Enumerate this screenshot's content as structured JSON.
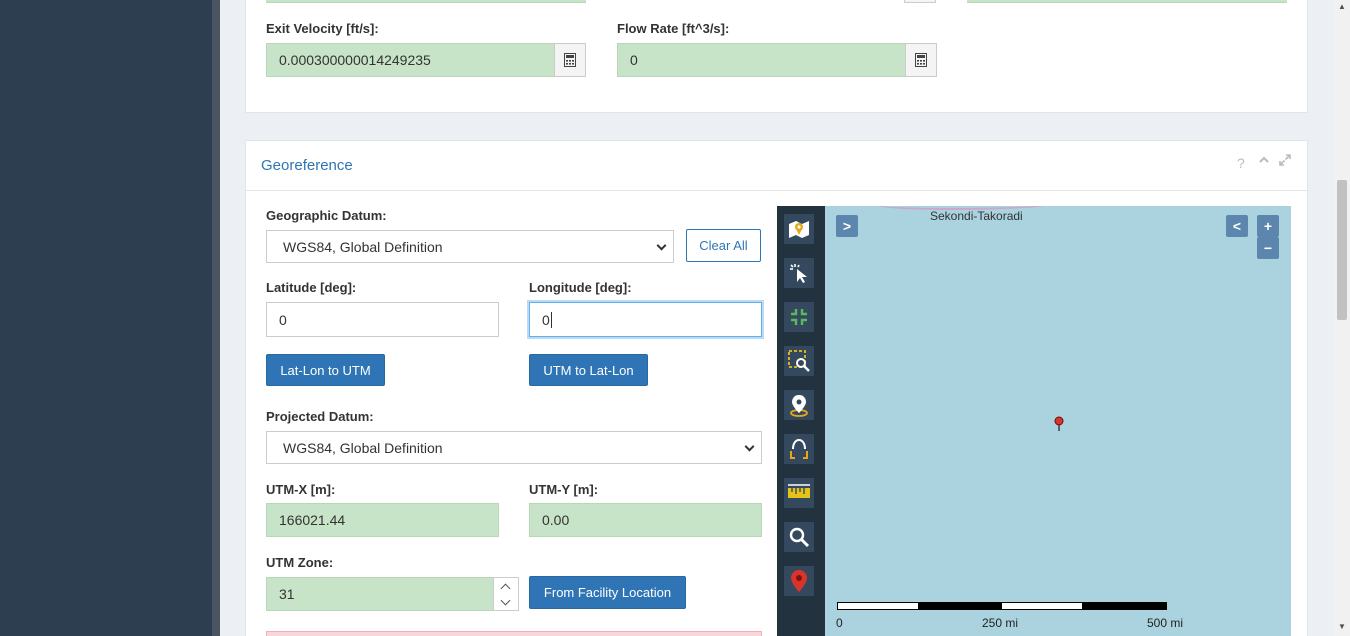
{
  "flow_section": {
    "exit_velocity": {
      "label": "Exit Velocity [ft/s]:",
      "value": "0.000300000014249235"
    },
    "flow_rate": {
      "label": "Flow Rate [ft^3/s]:",
      "value": "0"
    }
  },
  "georeference": {
    "title": "Georeference",
    "geographic_datum": {
      "label": "Geographic Datum:",
      "selected": "WGS84, Global Definition"
    },
    "clear_all": "Clear All",
    "latitude": {
      "label": "Latitude [deg]:",
      "value": "0"
    },
    "longitude": {
      "label": "Longitude [deg]:",
      "value": "0"
    },
    "latlon_to_utm": "Lat-Lon to UTM",
    "utm_to_latlon": "UTM to Lat-Lon",
    "projected_datum": {
      "label": "Projected Datum:",
      "selected": "WGS84, Global Definition"
    },
    "utm_x": {
      "label": "UTM-X [m]:",
      "value": "166021.44"
    },
    "utm_y": {
      "label": "UTM-Y [m]:",
      "value": "0.00"
    },
    "utm_zone": {
      "label": "UTM Zone:",
      "value": "31"
    },
    "from_facility": "From Facility Location"
  },
  "map": {
    "city_label": "Sekondi-Takoradi",
    "scale_labels": [
      "0",
      "250 mi",
      "500 mi"
    ],
    "controls": {
      "expand": ">",
      "collapse": "<",
      "zoom_in": "+",
      "zoom_out": "−"
    },
    "tools": [
      "map-layers-icon",
      "select-pointer-icon",
      "fit-extent-icon",
      "zoom-box-icon",
      "location-pin-icon",
      "orbit-icon",
      "ruler-icon",
      "search-icon",
      "red-marker-icon"
    ]
  },
  "colors": {
    "accent": "#2f75b5",
    "readonly_green": "#c8e4c8",
    "map_water": "#aad3df",
    "sidebar": "#2d3e50"
  }
}
